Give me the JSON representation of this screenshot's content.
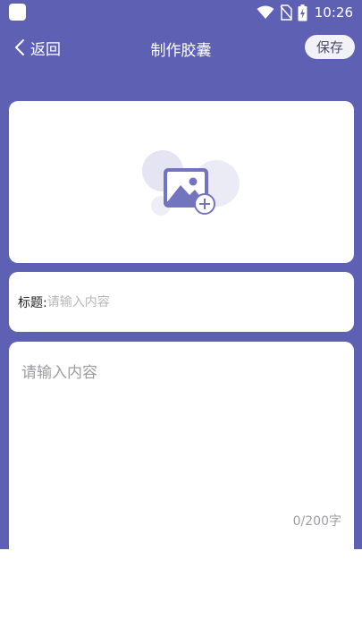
{
  "status_bar": {
    "time": "10:26",
    "icons": [
      "app-notification-icon",
      "wifi-icon",
      "no-sim-icon",
      "battery-charging-icon"
    ]
  },
  "header": {
    "back_label": "返回",
    "title": "制作胶囊",
    "save_label": "保存"
  },
  "image_card": {
    "icon": "add-image-icon"
  },
  "title_field": {
    "label": "标题:",
    "placeholder": "请输入内容",
    "value": ""
  },
  "content_field": {
    "placeholder": "请输入内容",
    "value": "",
    "counter": "0/200字"
  },
  "colors": {
    "primary": "#5d60b3",
    "card_bg": "#ffffff",
    "placeholder": "#9c9ca2",
    "icon_light": "#e4e4f2",
    "icon_accent": "#7274bd"
  }
}
